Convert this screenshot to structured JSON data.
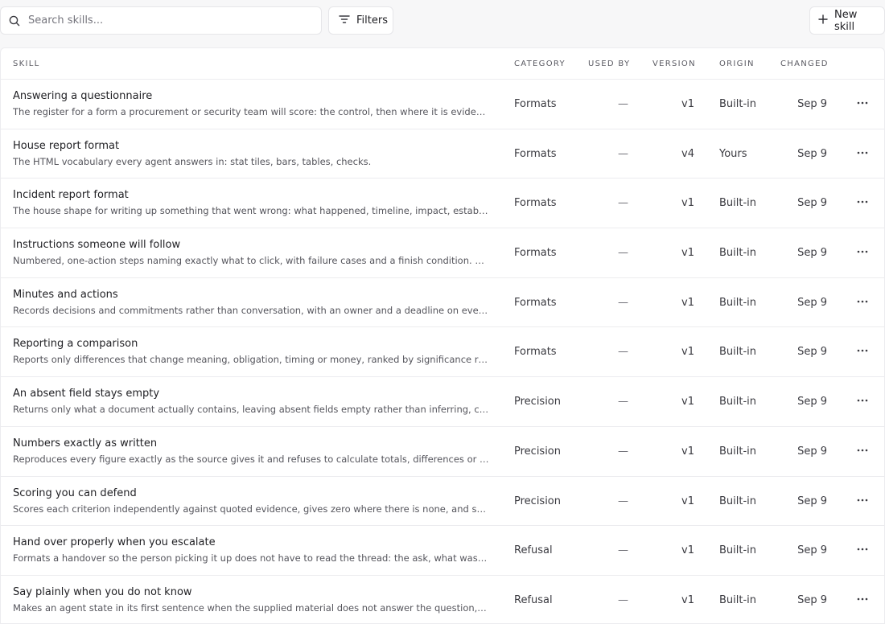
{
  "toolbar": {
    "search_placeholder": "Search skills...",
    "filters_label": "Filters",
    "new_skill_label": "New skill"
  },
  "table": {
    "columns": {
      "skill": "SKILL",
      "category": "CATEGORY",
      "used_by": "USED BY",
      "version": "VERSION",
      "origin": "ORIGIN",
      "changed": "CHANGED"
    },
    "rows": [
      {
        "name": "Answering a questionnaire",
        "desc": "The register for a form a procurement or security team will score: the control, then where it is evidenced, then the owner.",
        "category": "Formats",
        "used_by": "—",
        "version": "v1",
        "origin": "Built-in",
        "changed": "Sep 9"
      },
      {
        "name": "House report format",
        "desc": "The HTML vocabulary every agent answers in: stat tiles, bars, tables, checks.",
        "category": "Formats",
        "used_by": "—",
        "version": "v4",
        "origin": "Yours",
        "changed": "Sep 9"
      },
      {
        "name": "Incident report format",
        "desc": "The house shape for writing up something that went wrong: what happened, timeline, impact, established cause, actions.",
        "category": "Formats",
        "used_by": "—",
        "version": "v1",
        "origin": "Built-in",
        "changed": "Sep 9"
      },
      {
        "name": "Instructions someone will follow",
        "desc": "Numbered, one-action steps naming exactly what to click, with failure cases and a finish condition. Use for how-to answers.",
        "category": "Formats",
        "used_by": "—",
        "version": "v1",
        "origin": "Built-in",
        "changed": "Sep 9"
      },
      {
        "name": "Minutes and actions",
        "desc": "Records decisions and commitments rather than conversation, with an owner and a deadline on every action.",
        "category": "Formats",
        "used_by": "—",
        "version": "v1",
        "origin": "Built-in",
        "changed": "Sep 9"
      },
      {
        "name": "Reporting a comparison",
        "desc": "Reports only differences that change meaning, obligation, timing or money, ranked by significance rather than position.",
        "category": "Formats",
        "used_by": "—",
        "version": "v1",
        "origin": "Built-in",
        "changed": "Sep 9"
      },
      {
        "name": "An absent field stays empty",
        "desc": "Returns only what a document actually contains, leaving absent fields empty rather than inferring, computing or guessing.",
        "category": "Precision",
        "used_by": "—",
        "version": "v1",
        "origin": "Built-in",
        "changed": "Sep 9"
      },
      {
        "name": "Numbers exactly as written",
        "desc": "Reproduces every figure exactly as the source gives it and refuses to calculate totals, differences or percentages.",
        "category": "Precision",
        "used_by": "—",
        "version": "v1",
        "origin": "Built-in",
        "changed": "Sep 9"
      },
      {
        "name": "Scoring you can defend",
        "desc": "Scores each criterion independently against quoted evidence, gives zero where there is none, and says why.",
        "category": "Precision",
        "used_by": "—",
        "version": "v1",
        "origin": "Built-in",
        "changed": "Sep 9"
      },
      {
        "name": "Hand over properly when you escalate",
        "desc": "Formats a handover so the person picking it up does not have to read the thread: the ask, what was established, what is open.",
        "category": "Refusal",
        "used_by": "—",
        "version": "v1",
        "origin": "Built-in",
        "changed": "Sep 9"
      },
      {
        "name": "Say plainly when you do not know",
        "desc": "Makes an agent state in its first sentence when the supplied material does not answer the question, instead of guessing.",
        "category": "Refusal",
        "used_by": "—",
        "version": "v1",
        "origin": "Built-in",
        "changed": "Sep 9"
      }
    ]
  }
}
